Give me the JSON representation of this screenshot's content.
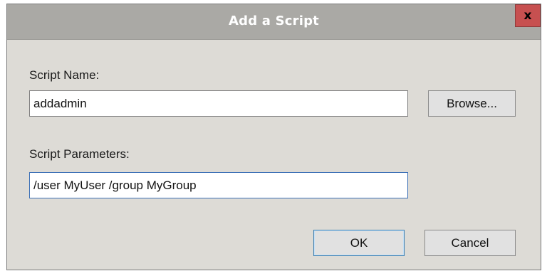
{
  "dialog": {
    "title": "Add a Script",
    "close_glyph": "x",
    "close_icon": "close-icon"
  },
  "script_name": {
    "label": "Script Name:",
    "value": "addadmin",
    "browse_label": "Browse..."
  },
  "script_parameters": {
    "label": "Script Parameters:",
    "value": "/user MyUser /group MyGroup"
  },
  "actions": {
    "ok_label": "OK",
    "cancel_label": "Cancel"
  },
  "colors": {
    "titlebar": "#aaa9a5",
    "dialog_background": "#dddbd6",
    "close_button": "#c75050",
    "focus_border": "#3b6fb6"
  }
}
